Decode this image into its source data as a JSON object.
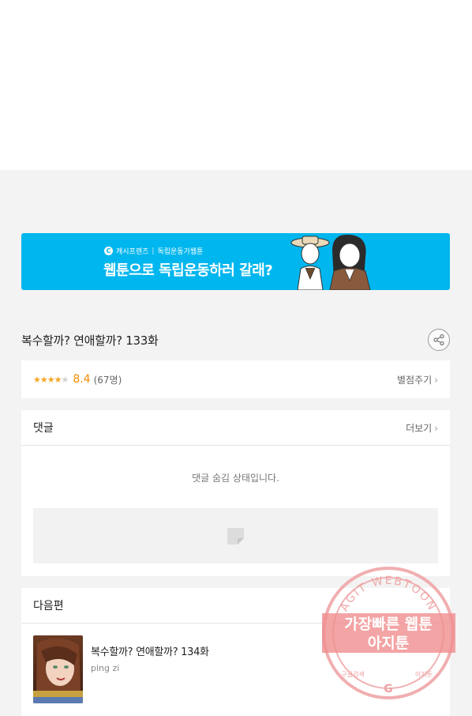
{
  "banner": {
    "brand": "캐시프렌즈",
    "category": "독립운동가웹툰",
    "headline": "웹툰으로 독립운동하러 갈래?"
  },
  "episode": {
    "title": "복수할까? 연애할까? 133화"
  },
  "rating": {
    "stars_filled": 4,
    "stars_total": 5,
    "score": "8.4",
    "votes": "(67명)",
    "rate_label": "별점주기"
  },
  "comments": {
    "header": "댓글",
    "more_label": "더보기",
    "hidden_message": "댓글 숨김 상태입니다."
  },
  "next_episode": {
    "header": "다음편",
    "title": "복수할까? 연애할까? 134화",
    "author": "ping zi"
  },
  "watermark": {
    "arc_text": "AGIT WEBTOON",
    "line1": "가장빠른 웹툰",
    "line2": "아지툰",
    "bottom_left": "구글검색",
    "bottom_right": "아지툰"
  },
  "colors": {
    "banner_bg": "#00b6ee",
    "star": "#f5a623",
    "score": "#f28b00",
    "watermark": "#e8888a"
  }
}
